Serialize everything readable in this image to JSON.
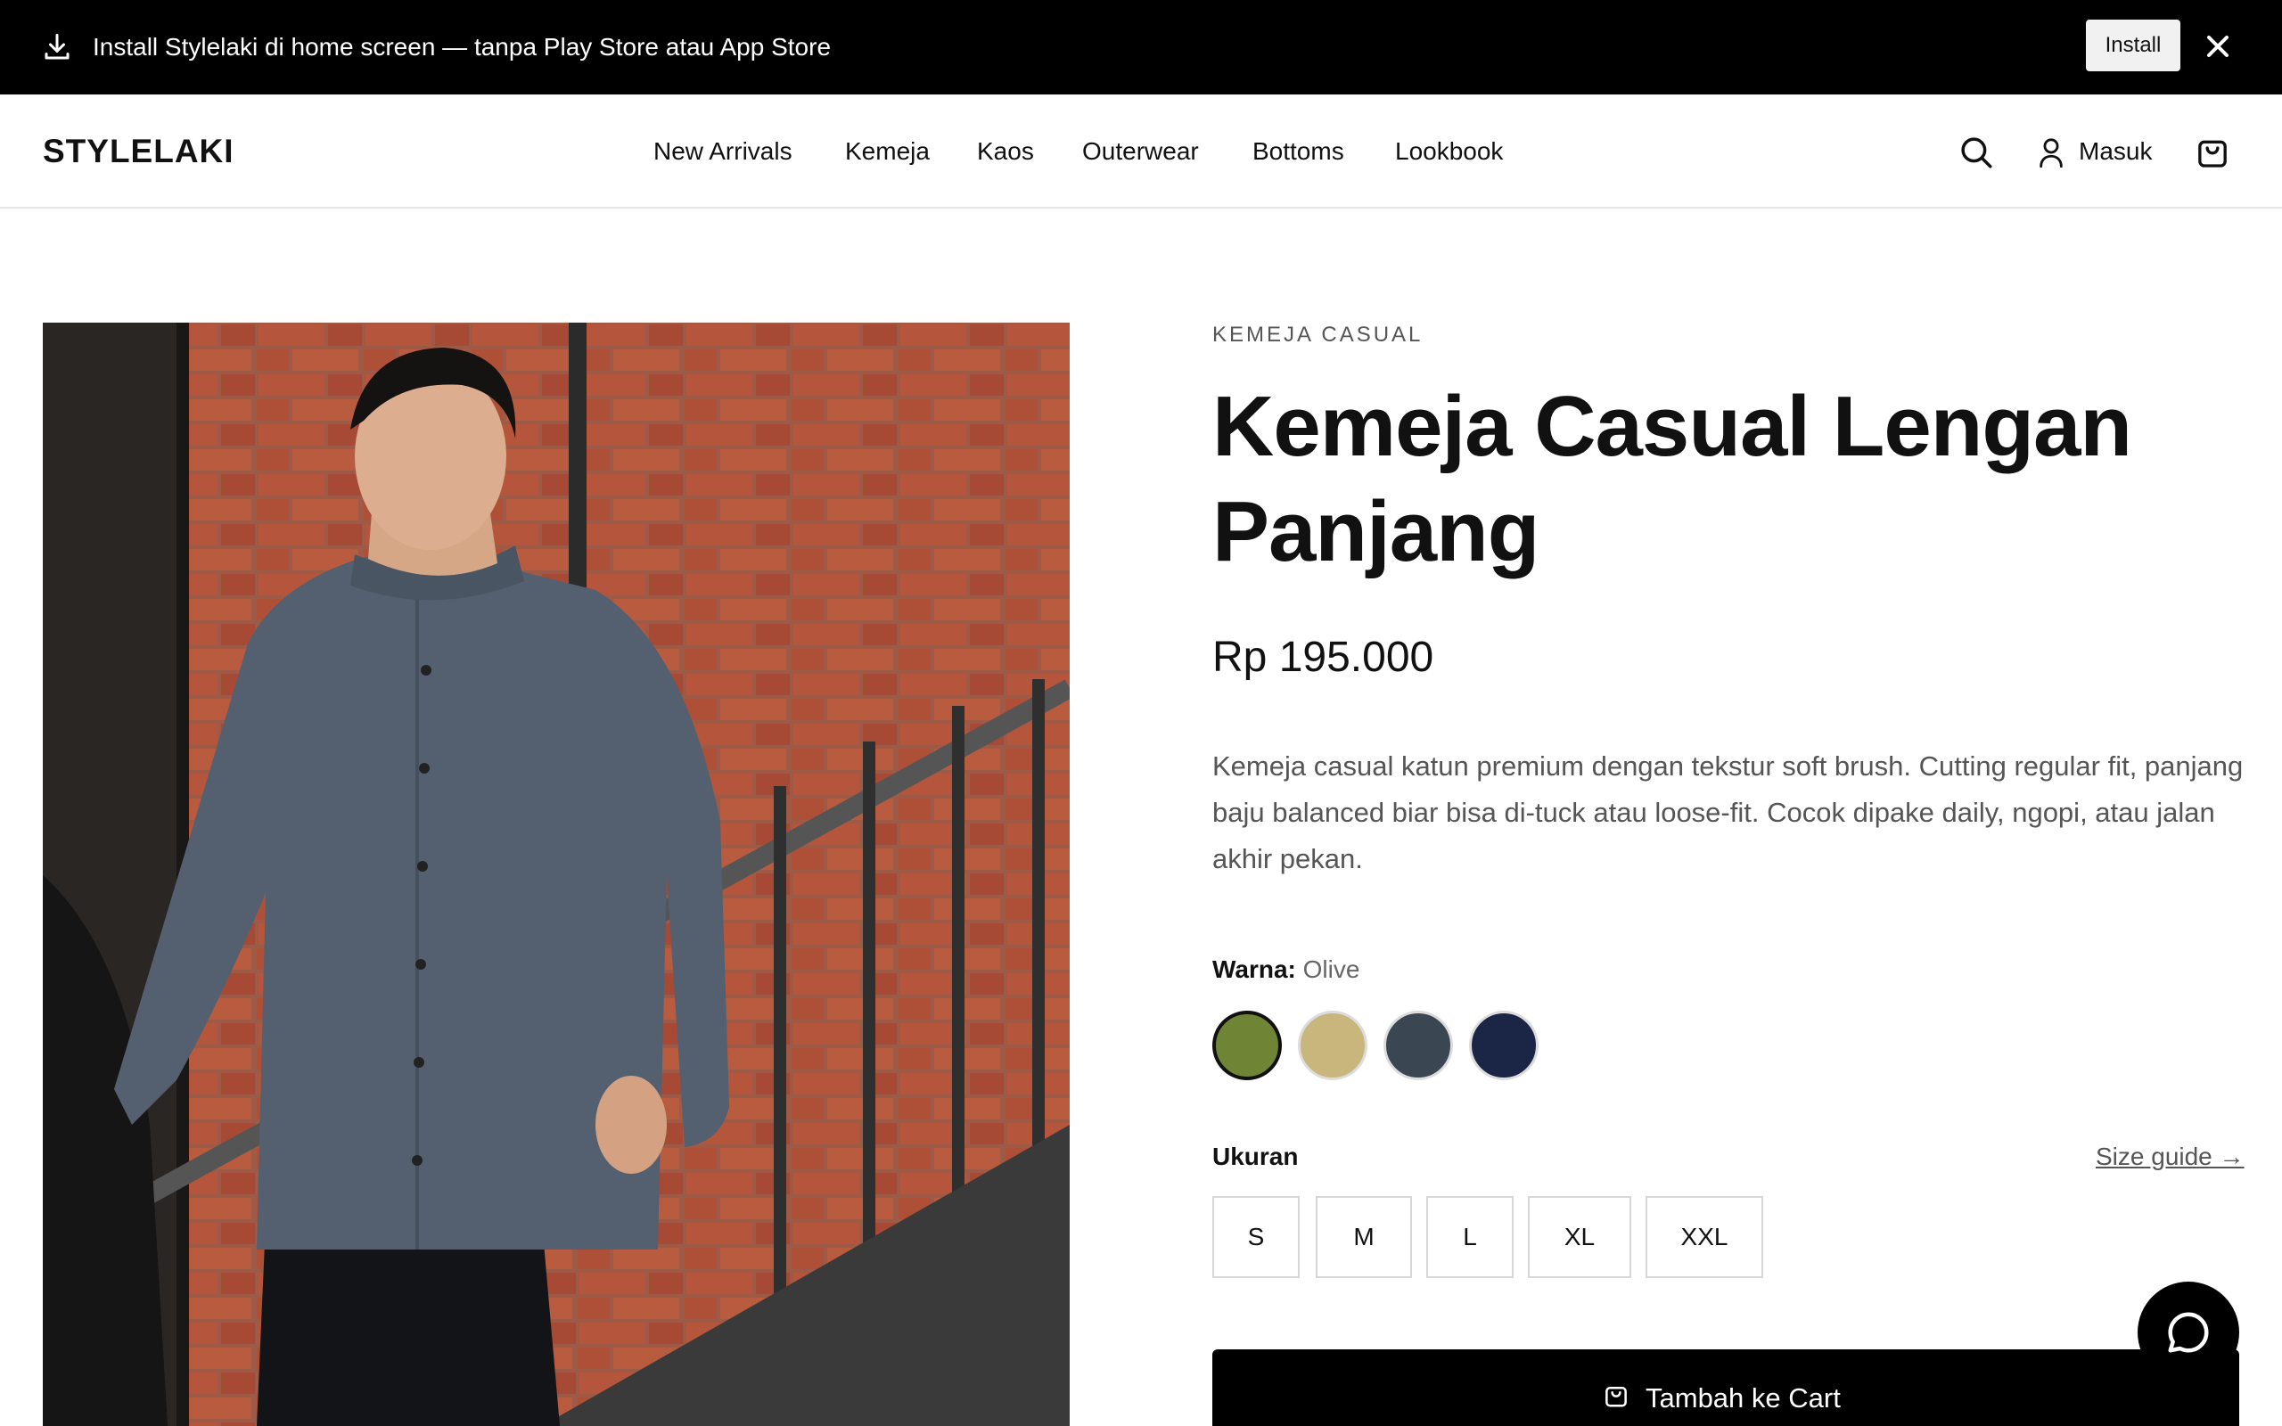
{
  "install_banner": {
    "text": "Install Stylelaki di home screen — tanpa Play Store atau App Store",
    "install_label": "Install"
  },
  "header": {
    "logo": "STYLELAKI",
    "nav": [
      "New Arrivals",
      "Kemeja",
      "Kaos",
      "Outerwear",
      "Bottoms",
      "Lookbook"
    ],
    "login_label": "Masuk"
  },
  "product": {
    "category": "KEMEJA CASUAL",
    "title": "Kemeja Casual Lengan Panjang",
    "price": "Rp 195.000",
    "description": "Kemeja casual katun premium dengan tekstur soft brush. Cutting regular fit, panjang baju balanced biar bisa di-tuck atau loose-fit. Cocok dipake daily, ngopi, atau jalan akhir pekan.",
    "color_label": "Warna:",
    "color_selected": "Olive",
    "colors": [
      "#6f8434",
      "#c8b67d",
      "#3a4753",
      "#1b2646"
    ],
    "size_label": "Ukuran",
    "size_guide": "Size guide →",
    "sizes": [
      "S",
      "M",
      "L",
      "XL",
      "XXL"
    ],
    "add_to_cart": "Tambah ke Cart"
  }
}
